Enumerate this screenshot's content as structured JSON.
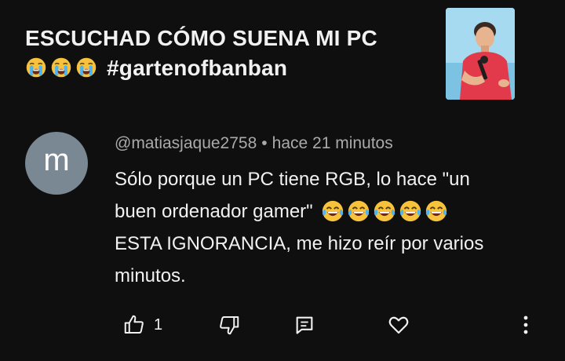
{
  "video": {
    "title_line1": "ESCUCHAD CÓMO SUENA MI PC",
    "title_hashtag": "#gartenofbanban",
    "title_emojis": [
      "loudly-crying-face",
      "loudly-crying-face",
      "loudly-crying-face"
    ]
  },
  "comment": {
    "avatar_letter": "m",
    "author": "@matiasjaque2758",
    "separator": "•",
    "time": "hace 21 minutos",
    "text_line1": "Sólo porque un PC tiene RGB, lo hace \"un",
    "text_line2": "buen ordenador gamer\"",
    "text_emojis": [
      "face-with-tears-of-joy",
      "face-with-tears-of-joy",
      "face-with-tears-of-joy",
      "face-with-tears-of-joy",
      "face-with-tears-of-joy"
    ],
    "text_line3": "ESTA IGNORANCIA, me hizo reír por varios",
    "text_line4": "minutos."
  },
  "actions": {
    "like_count": "1",
    "icons": [
      "thumbs-up-icon",
      "thumbs-down-icon",
      "reply-icon",
      "heart-icon",
      "more-vertical-icon"
    ]
  },
  "colors": {
    "background": "#0f0f0f",
    "text_primary": "#f1f1f1",
    "text_secondary": "#aaaaaa",
    "avatar_bg": "#7a8893",
    "shirt_red": "#e23a4a"
  }
}
